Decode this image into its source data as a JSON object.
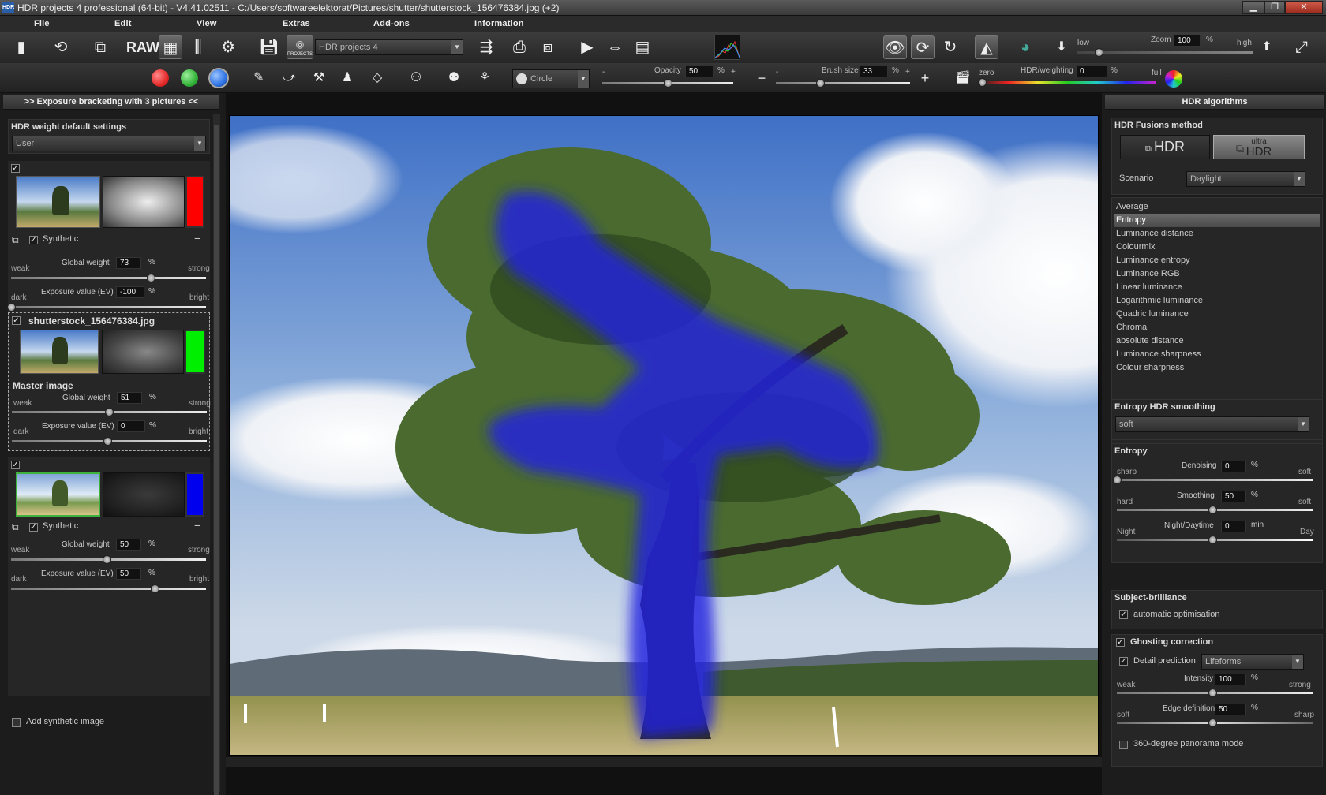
{
  "window": {
    "title": "HDR projects 4 professional (64-bit) - V4.41.02511 - C:/Users/softwareelektorat/Pictures/shutter/shutterstock_156476384.jpg (+2)",
    "app_icon": "HDR"
  },
  "menu": [
    "File",
    "Edit",
    "View",
    "Extras",
    "Add-ons",
    "Information"
  ],
  "toolbar": {
    "raw_label": "RAW",
    "projects_label": "PROJECTS",
    "preset_value": "HDR projects 4",
    "zoom": {
      "low": "low",
      "label": "Zoom",
      "value": "100",
      "unit": "%",
      "high": "high"
    }
  },
  "brushbar": {
    "shape_value": "Circle",
    "opacity": {
      "label": "Opacity",
      "value": "50",
      "unit": "%",
      "min": "-",
      "max": "+",
      "level": 0.5
    },
    "brush_size": {
      "label": "Brush size",
      "value": "33",
      "unit": "%",
      "min": "-",
      "max": "+",
      "level": 0.33
    },
    "weighting": {
      "zero": "zero",
      "label": "HDR/weighting",
      "value": "0",
      "unit": "%",
      "full": "full"
    },
    "colors": {
      "red": "#e52a2a",
      "green": "#34b33a",
      "blue": "#2f74e6"
    }
  },
  "left_panel": {
    "header": ">> Exposure bracketing with 3 pictures <<",
    "defaults": {
      "title": "HDR weight default settings",
      "select_value": "User"
    },
    "images": [
      {
        "filename": "",
        "synthetic_label": "Synthetic",
        "color": "#ff0000",
        "global_weight": {
          "weak": "weak",
          "label": "Global weight",
          "value": "73",
          "unit": "%",
          "strong": "strong",
          "level": 0.73
        },
        "exposure": {
          "dark": "dark",
          "label": "Exposure value (EV)",
          "value": "-100",
          "unit": "%",
          "bright": "bright",
          "level": 0.0
        }
      },
      {
        "filename": "shutterstock_156476384.jpg",
        "master_label": "Master image",
        "color": "#00ee00",
        "global_weight": {
          "weak": "weak",
          "label": "Global weight",
          "value": "51",
          "unit": "%",
          "strong": "strong",
          "level": 0.51
        },
        "exposure": {
          "dark": "dark",
          "label": "Exposure value (EV)",
          "value": "0",
          "unit": "%",
          "bright": "bright",
          "level": 0.5
        }
      },
      {
        "filename": "",
        "synthetic_label": "Synthetic",
        "color": "#0000ee",
        "global_weight": {
          "weak": "weak",
          "label": "Global weight",
          "value": "50",
          "unit": "%",
          "strong": "strong",
          "level": 0.5
        },
        "exposure": {
          "dark": "dark",
          "label": "Exposure value (EV)",
          "value": "50",
          "unit": "%",
          "bright": "bright",
          "level": 0.75
        }
      }
    ],
    "add_synthetic": "Add synthetic image"
  },
  "right_panel": {
    "header": "HDR algorithms",
    "fusion": {
      "title": "HDR Fusions method",
      "hdr_label": "HDR",
      "ultra_label_1": "ultra",
      "ultra_label_2": "HDR",
      "scenario_label": "Scenario",
      "scenario_value": "Daylight"
    },
    "algorithms": [
      "Average",
      "Entropy",
      "Luminance distance",
      "Colourmix",
      "Luminance entropy",
      "Luminance RGB",
      "Linear luminance",
      "Logarithmic luminance",
      "Quadric luminance",
      "Chroma",
      "absolute distance",
      "Luminance sharpness",
      "Colour sharpness"
    ],
    "selected_algorithm": "Entropy",
    "smoothing": {
      "title": "Entropy HDR smoothing",
      "value": "soft"
    },
    "entropy": {
      "title": "Entropy",
      "denoising": {
        "left": "sharp",
        "label": "Denoising",
        "value": "0",
        "unit": "%",
        "right": "soft",
        "level": 0.0
      },
      "smoothing": {
        "left": "hard",
        "label": "Smoothing",
        "value": "50",
        "unit": "%",
        "right": "soft",
        "level": 0.5
      },
      "night": {
        "left": "Night",
        "label": "Night/Daytime",
        "value": "0",
        "unit": "min",
        "right": "Day",
        "level": 0.5
      }
    },
    "brilliance": {
      "title": "Subject-brilliance",
      "auto": "automatic optimisation"
    },
    "ghosting": {
      "title": "Ghosting correction",
      "detail_label": "Detail prediction",
      "detail_value": "Lifeforms",
      "intensity": {
        "left": "weak",
        "label": "Intensity",
        "value": "100",
        "unit": "%",
        "right": "strong",
        "level": 0.5
      },
      "edge": {
        "left": "soft",
        "label": "Edge definition",
        "value": "50",
        "unit": "%",
        "right": "sharp",
        "level": 0.5
      },
      "panorama": "360-degree panorama mode"
    }
  }
}
